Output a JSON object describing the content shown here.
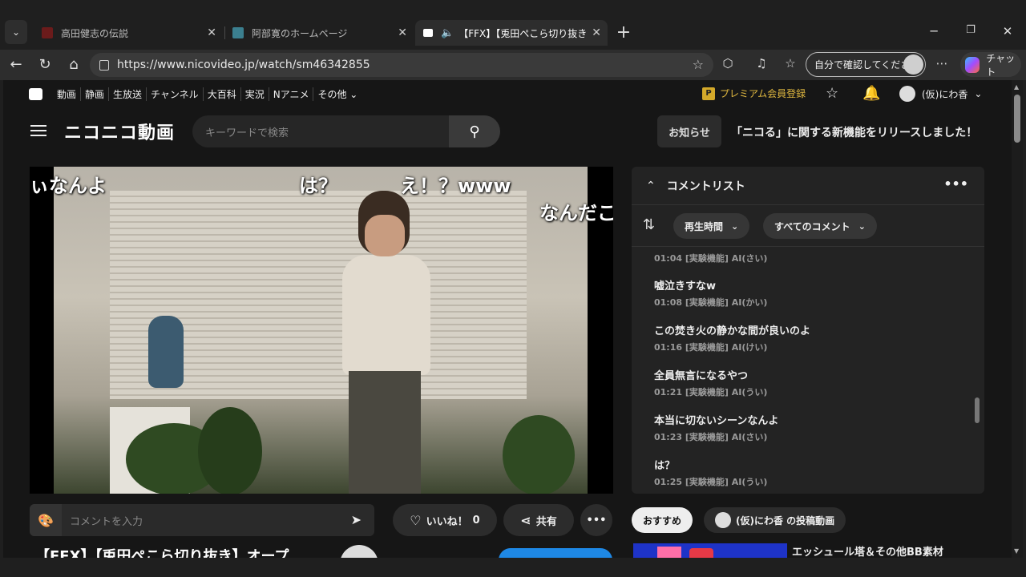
{
  "browser": {
    "tabs": [
      {
        "title": "高田健志の伝説",
        "active": false,
        "favicon_color": "#c62828"
      },
      {
        "title": "阿部寛のホームページ",
        "active": false,
        "favicon_color": "#3b7f8f"
      },
      {
        "title": "【FFX】【兎田ぺこら切り抜き】オープ",
        "active": true,
        "favicon_color": "#ffffff"
      }
    ],
    "new_tab_label": "+",
    "url": "https://www.nicovideo.jp/watch/sm46342855",
    "profile_label": "自分で確認してください",
    "copilot_label": "チャット"
  },
  "nico": {
    "global_nav": [
      "動画",
      "静画",
      "生放送",
      "チャンネル",
      "大百科",
      "実況",
      "Nアニメ",
      "その他 ⌄"
    ],
    "premium_label": "プレミアム会員登録",
    "premium_badge": "P",
    "user_name": "(仮)にわ香",
    "logo_text": "ニコニコ動画",
    "search_placeholder": "キーワードで検索",
    "notice_label": "お知らせ",
    "notice_text": "「ニコる」に関する新機能をリリースしました！"
  },
  "player": {
    "overlay_comments": [
      {
        "text": "ぃなんよ"
      },
      {
        "text": "は？"
      },
      {
        "text": "え！？www"
      },
      {
        "text": "なんだこ"
      }
    ],
    "comment_placeholder": "コメントを入力",
    "like_label": "いいね！",
    "like_count": "0",
    "share_label": "共有",
    "title_peek": "【FFX】【兎田ぺこら切り抜き】オープ"
  },
  "comment_panel": {
    "title": "コメントリスト",
    "sort_label": "再生時間",
    "filter_label": "すべてのコメント",
    "items": [
      {
        "text": "",
        "meta": "01:04 [実験機能] AI(さい)"
      },
      {
        "text": "嘘泣きすなw",
        "meta": "01:08 [実験機能] AI(かい)"
      },
      {
        "text": "この焚き火の静かな間が良いのよ",
        "meta": "01:16 [実験機能] AI(けい)"
      },
      {
        "text": "全員無言になるやつ",
        "meta": "01:21 [実験機能] AI(うい)"
      },
      {
        "text": "本当に切ないシーンなんよ",
        "meta": "01:23 [実験機能] AI(さい)"
      },
      {
        "text": "は？",
        "meta": "01:25 [実験機能] AI(うい)"
      }
    ]
  },
  "recommend": {
    "tab_recommend": "おすすめ",
    "tab_user_videos": "(仮)にわ香 の投稿動画",
    "first_title": "エッシュール塔＆その他BB素材"
  },
  "colors": {
    "accent_blue": "#1e88e5",
    "premium_gold": "#d4a92a"
  }
}
